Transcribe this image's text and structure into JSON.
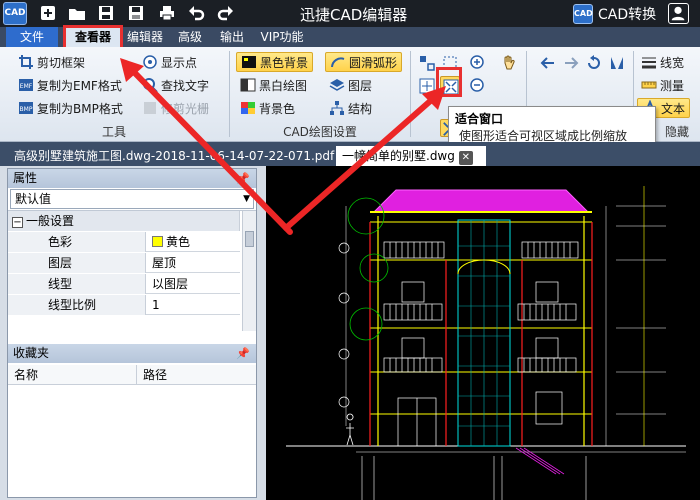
{
  "app": {
    "title": "迅捷CAD编辑器",
    "logo_text": "CAD",
    "convert_label": "CAD转换",
    "convert_badge": "CAD"
  },
  "menu": {
    "file": "文件",
    "items": [
      "查看器",
      "编辑器",
      "高级",
      "输出",
      "VIP功能"
    ],
    "active_index": 0
  },
  "ribbon": {
    "tools": {
      "label": "工具",
      "items": [
        "剪切框架",
        "复制为EMF格式",
        "复制为BMP格式",
        "显示点",
        "查找文字",
        "修剪光栅"
      ],
      "emf_tag": "EMF",
      "bmp_tag": "BMP"
    },
    "draw": {
      "label": "CAD绘图设置",
      "items": [
        "黑色背景",
        "黑白绘图",
        "背景色",
        "圆滑弧形",
        "图层",
        "结构"
      ]
    },
    "right": {
      "label": "隐藏",
      "items": [
        "线宽",
        "测量",
        "文本"
      ]
    }
  },
  "tooltip": {
    "title": "适合窗口",
    "desc": "使图形适合可视区域成比例缩放"
  },
  "tabs": [
    {
      "label": "高级别墅建筑施工图.dwg-2018-11-06-14-07-22-071.pdf",
      "close": ""
    },
    {
      "label": "一幢简单的别墅.dwg",
      "close": "✕"
    }
  ],
  "properties": {
    "title": "属性",
    "pin": "📌",
    "dropdown_value": "默认值",
    "group": "一般设置",
    "collapse": "−",
    "rows": [
      {
        "key": "色彩",
        "value": "黄色"
      },
      {
        "key": "图层",
        "value": "屋顶"
      },
      {
        "key": "线型",
        "value": "以图层"
      },
      {
        "key": "线型比例",
        "value": "1"
      }
    ]
  },
  "favorites": {
    "title": "收藏夹",
    "pin": "📌",
    "col_name": "名称",
    "col_path": "路径"
  },
  "colors": {
    "accent": "#2e6ccd",
    "titlebar": "#1b1f25",
    "menubar": "#3a4a63",
    "highlight": "#e83030",
    "canvas": "#000000",
    "roof": "#e020e0",
    "line": "#ffff00"
  }
}
